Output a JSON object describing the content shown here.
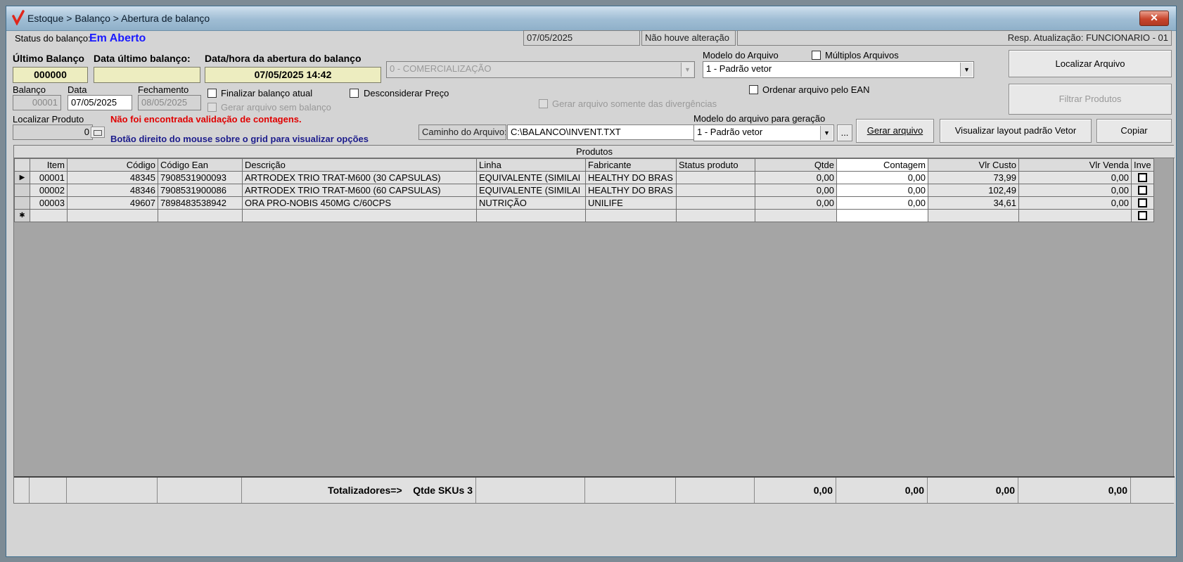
{
  "window": {
    "title": "Estoque > Balanço > Abertura de balanço",
    "close": "✕"
  },
  "status": {
    "label": "Status do balanço:",
    "value": "Em Aberto",
    "date": "07/05/2025",
    "change_text": "Não houve alteração",
    "resp": "Resp. Atualização: FUNCIONARIO - 01"
  },
  "header": {
    "ultimo_balanco_label": "Último Balanço",
    "ultimo_balanco_value": "000000",
    "data_ultimo_label": "Data último balanço:",
    "data_ultimo_value": "",
    "abertura_label": "Data/hora da abertura do balanço",
    "abertura_value": "07/05/2025 14:42",
    "tipo_select": "0 - COMERCIALIZAÇÃO"
  },
  "arquivo": {
    "modelo_label": "Modelo do Arquivo",
    "multiplos_label": "Múltiplos Arquivos",
    "modelo_value": "1 - Padrão vetor",
    "localizar_button": "Localizar Arquivo",
    "filtrar_button": "Filtrar Produtos",
    "ordenar_label": "Ordenar arquivo pelo EAN",
    "gerar_div_label": "Gerar arquivo somente das divergências"
  },
  "balanco": {
    "balanco_label": "Balanço",
    "balanco_value": "00001",
    "data_label": "Data",
    "data_value": "07/05/2025",
    "fechamento_label": "Fechamento",
    "fechamento_value": "08/05/2025",
    "finalizar_label": "Finalizar balanço atual",
    "gerar_sem_label": "Gerar arquivo sem balanço",
    "desconsiderar_label": "Desconsiderar Preço"
  },
  "localizar": {
    "label": "Localizar Produto",
    "value": "0",
    "msg_error": "Não foi encontrada validação de contagens.",
    "msg_info": "Botão direito do mouse sobre o grid para visualizar opções"
  },
  "geracao": {
    "caminho_label": "Caminho do Arquivo:",
    "caminho_value": "C:\\BALANCO\\INVENT.TXT",
    "modelo_geracao_label": "Modelo do arquivo para geração",
    "modelo_geracao_value": "1 - Padrão vetor",
    "browse_button": "...",
    "gerar_button": "Gerar arquivo",
    "visualizar_button": "Visualizar layout padrão Vetor",
    "copiar_button": "Copiar"
  },
  "grid": {
    "band_title": "Produtos",
    "columns": [
      "Item",
      "Código",
      "Código Ean",
      "Descrição",
      "Linha",
      "Fabricante",
      "Status produto",
      "Qtde",
      "Contagem",
      "Vlr Custo",
      "Vlr Venda",
      "Inve"
    ],
    "rows": [
      {
        "item": "00001",
        "codigo": "48345",
        "ean": "7908531900093",
        "descricao": "ARTRODEX TRIO TRAT-M600 (30 CAPSULAS)",
        "linha": "EQUIVALENTE (SIMILAI",
        "fabricante": "HEALTHY DO BRAS",
        "status": "",
        "qtde": "0,00",
        "contagem": "0,00",
        "custo": "73,99",
        "venda": "0,00"
      },
      {
        "item": "00002",
        "codigo": "48346",
        "ean": "7908531900086",
        "descricao": "ARTRODEX TRIO TRAT-M600 (60 CAPSULAS)",
        "linha": "EQUIVALENTE (SIMILAI",
        "fabricante": "HEALTHY DO BRAS",
        "status": "",
        "qtde": "0,00",
        "contagem": "0,00",
        "custo": "102,49",
        "venda": "0,00"
      },
      {
        "item": "00003",
        "codigo": "49607",
        "ean": "7898483538942",
        "descricao": "ORA PRO-NOBIS 450MG C/60CPS",
        "linha": "NUTRIÇÃO",
        "fabricante": "UNILIFE",
        "status": "",
        "qtde": "0,00",
        "contagem": "0,00",
        "custo": "34,61",
        "venda": "0,00"
      }
    ],
    "current_marker": "▶",
    "new_marker": "✱"
  },
  "totals": {
    "label": "Totalizadores=>",
    "skus": "Qtde SKUs 3",
    "qtde": "0,00",
    "contagem": "0,00",
    "custo": "0,00",
    "venda": "0,00"
  },
  "colors": {
    "status_blue": "#1a1aff",
    "error_red": "#e00000",
    "info_navy": "#1c1c8c"
  },
  "icons": {
    "logo": "red-checkmark-icon",
    "browse": "ellipsis-button-icon",
    "localizar": "small-button-icon"
  }
}
